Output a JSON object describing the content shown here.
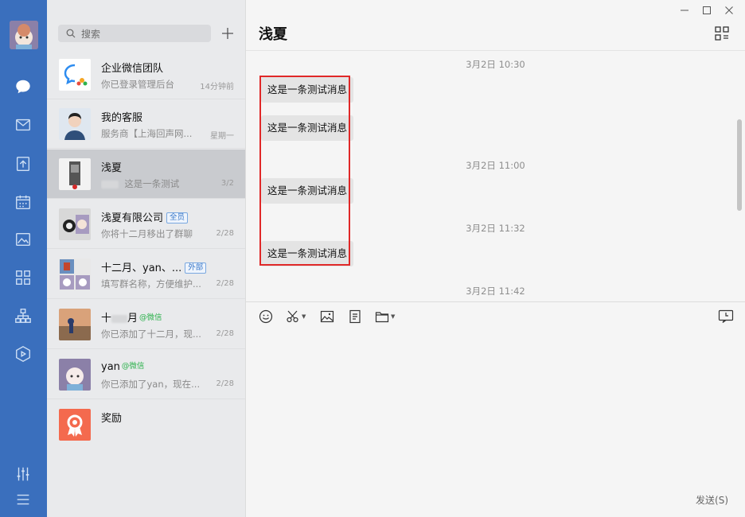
{
  "search": {
    "placeholder": "搜索"
  },
  "conversations": [
    {
      "name": "企业微信团队",
      "preview": "你已登录管理后台",
      "time": "14分钟前"
    },
    {
      "name": "我的客服",
      "preview": "服务商【上海回声网...",
      "time": "星期一"
    },
    {
      "name": "浅夏",
      "preview": "这是一条测试",
      "time": "3/2"
    },
    {
      "name": "浅夏有限公司",
      "tag": "全员",
      "preview": "你将十二月移出了群聊",
      "time": "2/28"
    },
    {
      "name": "十二月、yan、...",
      "tag": "外部",
      "preview": "填写群名称，方便维护...",
      "time": "2/28"
    },
    {
      "name": "十",
      "name_suffix": "月",
      "wechat": "@微信",
      "preview": "你已添加了十二月，现...",
      "time": "2/28"
    },
    {
      "name": "yan",
      "wechat": "@微信",
      "preview": "你已添加了yan，现在...",
      "time": "2/28"
    },
    {
      "name": "奖励",
      "preview": "",
      "time": ""
    }
  ],
  "chat": {
    "title": "浅夏",
    "timestamps": [
      "3月2日 10:30",
      "3月2日 11:00",
      "3月2日 11:32",
      "3月2日 11:42"
    ],
    "messages": [
      "这是一条测试消息",
      "这是一条测试消息",
      "这是一条测试消息",
      "这是一条测试消息"
    ],
    "send_label": "发送(S)"
  },
  "colors": {
    "rail": "#3a6fbd",
    "list_bg": "#e9eaec",
    "active_item": "#c9cbcf",
    "highlight_box": "#e02828",
    "bubble": "#e4e4e4"
  }
}
